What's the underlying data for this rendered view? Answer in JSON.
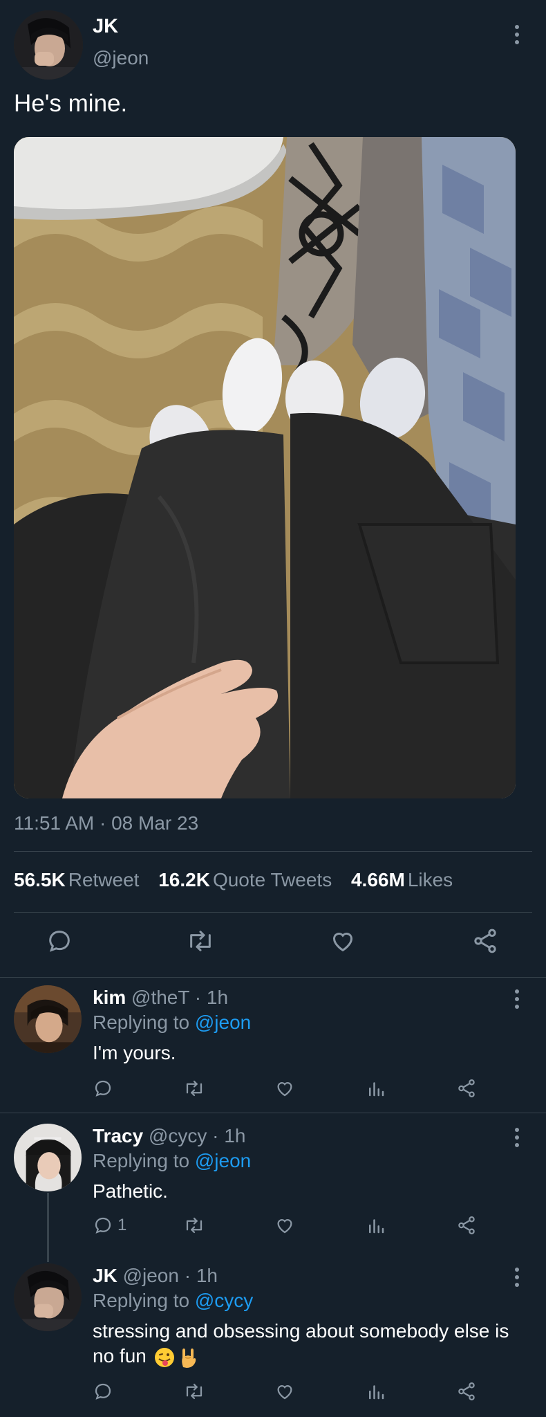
{
  "main_tweet": {
    "name": "JK",
    "handle": "@jeon",
    "text": "He's mine.",
    "timestamp": "11:51 AM · 08 Mar 23",
    "stats": [
      {
        "num": "56.5K",
        "label": "Retweet"
      },
      {
        "num": "16.2K",
        "label": "Quote Tweets"
      },
      {
        "num": "4.66M",
        "label": "Likes"
      }
    ]
  },
  "replies": [
    {
      "name": "kim",
      "handle": "@theT",
      "time": "1h",
      "replying_prefix": "Replying to",
      "replying_to": "@jeon",
      "text": "I'm yours.",
      "reply_count": ""
    },
    {
      "name": "Tracy",
      "handle": "@cycy",
      "time": "1h",
      "replying_prefix": "Replying to",
      "replying_to": "@jeon",
      "text": "Pathetic.",
      "reply_count": "1"
    },
    {
      "name": "JK",
      "handle": "@jeon",
      "time": "1h",
      "replying_prefix": "Replying to",
      "replying_to": "@cycy",
      "text": "stressing and obsessing about somebody else is no fun",
      "reply_count": ""
    }
  ],
  "colors": {
    "background": "#15202b",
    "secondary_text": "#8b98a5",
    "link": "#1d9bf0",
    "divider": "#38444d"
  },
  "icons": [
    "more-vertical-icon",
    "reply-icon",
    "retweet-icon",
    "like-icon",
    "analytics-icon",
    "share-icon"
  ]
}
